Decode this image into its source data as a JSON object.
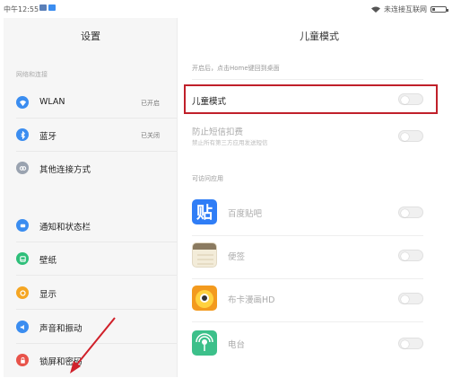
{
  "status": {
    "time": "中午12:55",
    "network": "未连接互联网"
  },
  "left": {
    "title": "设置",
    "section": "网络和连接",
    "items": [
      {
        "label": "WLAN",
        "value": "已开启",
        "icon": "wifi-icon",
        "color": "#3b8df0"
      },
      {
        "label": "蓝牙",
        "value": "已关闭",
        "icon": "bluetooth-icon",
        "color": "#3b8df0"
      },
      {
        "label": "其他连接方式",
        "value": "",
        "icon": "link-icon",
        "color": "#9aa3b0"
      },
      {
        "label": "通知和状态栏",
        "value": "",
        "icon": "notification-icon",
        "color": "#3b8df0"
      },
      {
        "label": "壁纸",
        "value": "",
        "icon": "wallpaper-icon",
        "color": "#2fbf7a"
      },
      {
        "label": "显示",
        "value": "",
        "icon": "display-icon",
        "color": "#f5a623"
      },
      {
        "label": "声音和振动",
        "value": "",
        "icon": "sound-icon",
        "color": "#3b8df0"
      },
      {
        "label": "锁屏和密码",
        "value": "",
        "icon": "lock-icon",
        "color": "#e8534a"
      }
    ]
  },
  "right": {
    "title": "儿童模式",
    "hint": "开启后，点击Home键回到桌面",
    "kids_mode": {
      "label": "儿童模式",
      "on": false
    },
    "sms": {
      "label": "防止短信扣费",
      "sub": "禁止所有第三方应用发送短信",
      "on": false
    },
    "apps_section": "可访问应用",
    "apps": [
      {
        "label": "百度贴吧",
        "icon": "baidu-tieba-icon",
        "on": false
      },
      {
        "label": "便签",
        "icon": "notes-icon",
        "on": false
      },
      {
        "label": "布卡漫画HD",
        "icon": "buka-comic-icon",
        "on": false
      },
      {
        "label": "电台",
        "icon": "radio-icon",
        "on": false
      }
    ]
  },
  "colors": {
    "highlight": "#c0202a",
    "arrow": "#d0202a",
    "accent": "#3b8df0"
  }
}
